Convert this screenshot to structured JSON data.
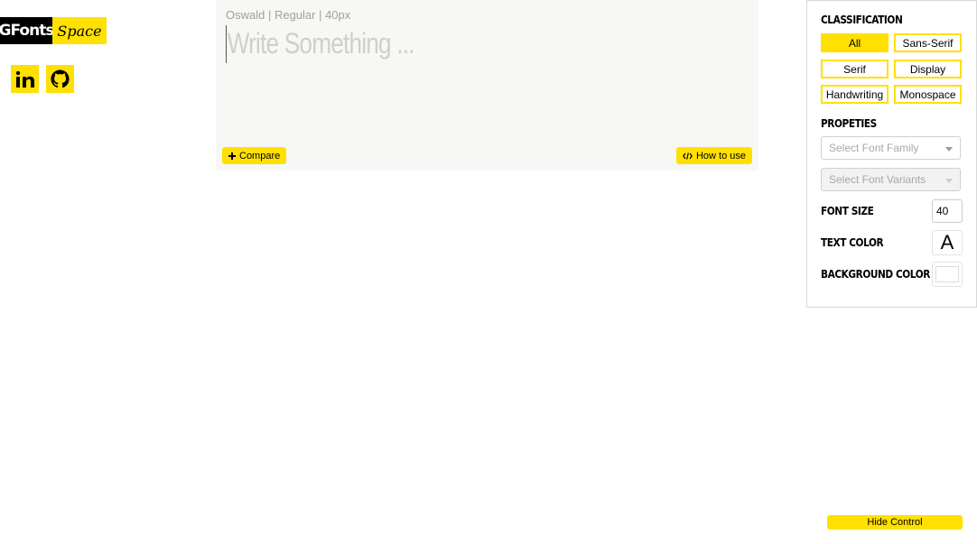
{
  "logo": {
    "left": "GFonts",
    "right": "Space"
  },
  "social": [
    {
      "name": "linkedin",
      "icon": "linkedin-icon"
    },
    {
      "name": "github",
      "icon": "github-icon"
    }
  ],
  "editor": {
    "meta": "Oswald | Regular | 40px",
    "placeholder": "Write Something ...",
    "compare_label": "Compare",
    "howto_label": "How to use"
  },
  "panel": {
    "classification_heading": "CLASSIFICATION",
    "classifications": [
      "All",
      "Sans-Serif",
      "Serif",
      "Display",
      "Handwriting",
      "Monospace"
    ],
    "active_classification": "All",
    "properties_heading": "PROPETIES",
    "font_family_placeholder": "Select Font Family",
    "font_variants_placeholder": "Select Font Variants",
    "font_size_label": "FONT SIZE",
    "font_size_value": "40",
    "text_color_label": "TEXT COLOR",
    "text_color_sample": "A",
    "background_color_label": "BACKGROUND COLOR"
  },
  "hide_control_label": "Hide Control",
  "colors": {
    "accent": "#ffe000",
    "editor_bg": "#f7f7f5"
  }
}
